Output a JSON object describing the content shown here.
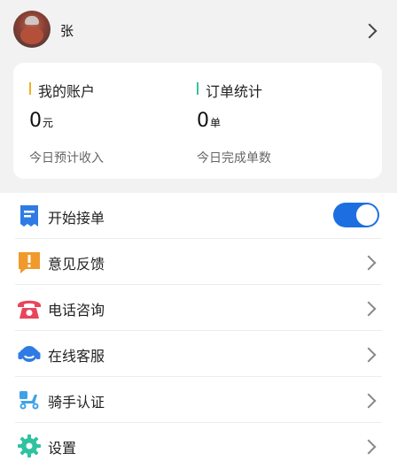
{
  "profile": {
    "name": "张"
  },
  "stats": {
    "account": {
      "title": "我的账户",
      "value": "0",
      "unit": "元",
      "subtitle": "今日预计收入",
      "accent_color": "#f2b01e"
    },
    "orders": {
      "title": "订单统计",
      "value": "0",
      "unit": "单",
      "subtitle": "今日完成单数",
      "accent_color": "#3bbfa0"
    }
  },
  "menu": {
    "items": [
      {
        "label": "开始接单",
        "icon": "receipt-icon",
        "icon_color": "#2f7be5",
        "control": "toggle",
        "toggle_on": true
      },
      {
        "label": "意见反馈",
        "icon": "feedback-icon",
        "icon_color": "#f09a2c",
        "control": "chevron"
      },
      {
        "label": "电话咨询",
        "icon": "phone-icon",
        "icon_color": "#e9455c",
        "control": "chevron"
      },
      {
        "label": "在线客服",
        "icon": "headset-icon",
        "icon_color": "#2f7be5",
        "control": "chevron"
      },
      {
        "label": "骑手认证",
        "icon": "scooter-icon",
        "icon_color": "#3fa2e8",
        "control": "chevron"
      },
      {
        "label": "设置",
        "icon": "gear-icon",
        "icon_color": "#2fc2a0",
        "control": "chevron"
      }
    ]
  },
  "colors": {
    "toggle_on": "#1d6fe1",
    "background": "#f2f2f2"
  }
}
